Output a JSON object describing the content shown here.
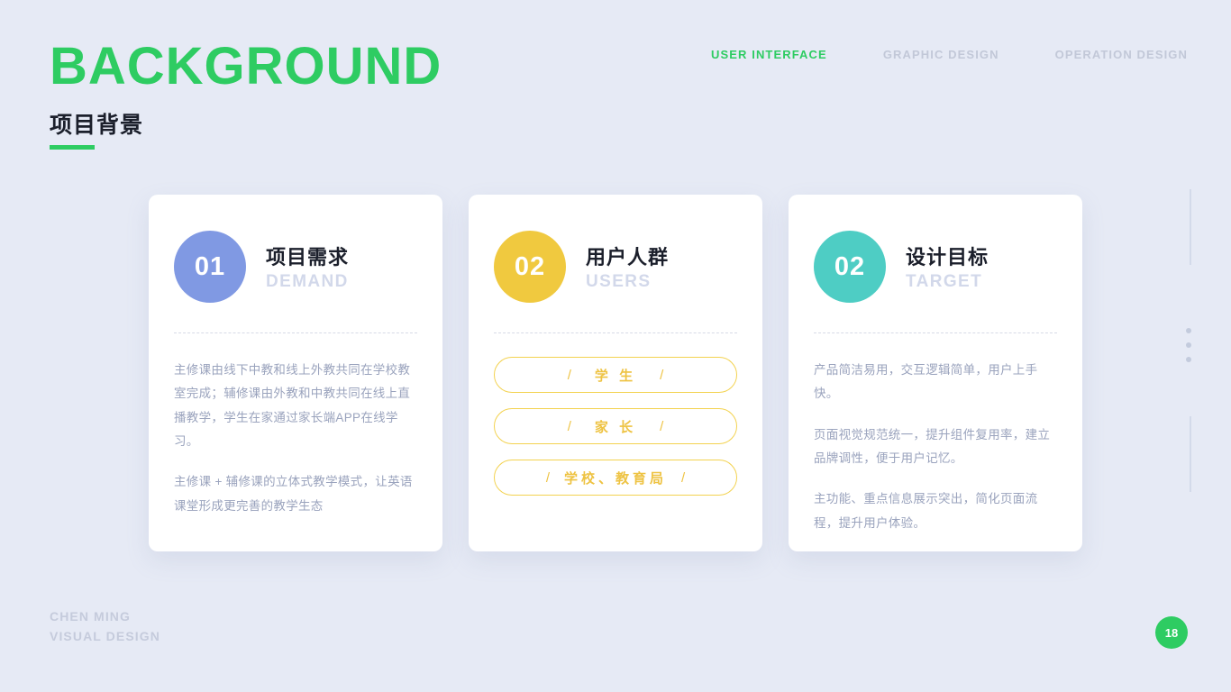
{
  "header": {
    "title_main": "BACKGROUND",
    "title_sub": "项目背景",
    "accent_color": "#2ecc62"
  },
  "topnav": {
    "items": [
      {
        "label": "USER INTERFACE",
        "active": true
      },
      {
        "label": "GRAPHIC DESIGN",
        "active": false
      },
      {
        "label": "OPERATION DESIGN",
        "active": false
      }
    ]
  },
  "cards": [
    {
      "number": "01",
      "circle_color": "#8099e3",
      "title_cn": "项目需求",
      "title_en": "DEMAND",
      "paragraphs": [
        "主修课由线下中教和线上外教共同在学校教室完成；辅修课由外教和中教共同在线上直播教学，学生在家通过家长端APP在线学习。",
        "主修课 + 辅修课的立体式教学模式，让英语课堂形成更完善的教学生态"
      ]
    },
    {
      "number": "02",
      "circle_color": "#f0c93f",
      "title_cn": "用户人群",
      "title_en": "USERS",
      "pills": [
        {
          "slash_left": "/",
          "label": "学 生",
          "slash_right": "/"
        },
        {
          "slash_left": "/",
          "label": "家 长",
          "slash_right": "/"
        },
        {
          "slash_left": "/",
          "label": "学校、教育局",
          "slash_right": "/"
        }
      ]
    },
    {
      "number": "02",
      "circle_color": "#4ecdc4",
      "title_cn": "设计目标",
      "title_en": "TARGET",
      "paragraphs": [
        "产品简洁易用，交互逻辑简单，用户上手快。",
        "页面视觉规范统一，提升组件复用率，建立品牌调性，便于用户记忆。",
        "主功能、重点信息展示突出，简化页面流程，提升用户体验。"
      ]
    }
  ],
  "footer": {
    "line1": "CHEN MING",
    "line2": "VISUAL DESIGN"
  },
  "page_number": "18"
}
